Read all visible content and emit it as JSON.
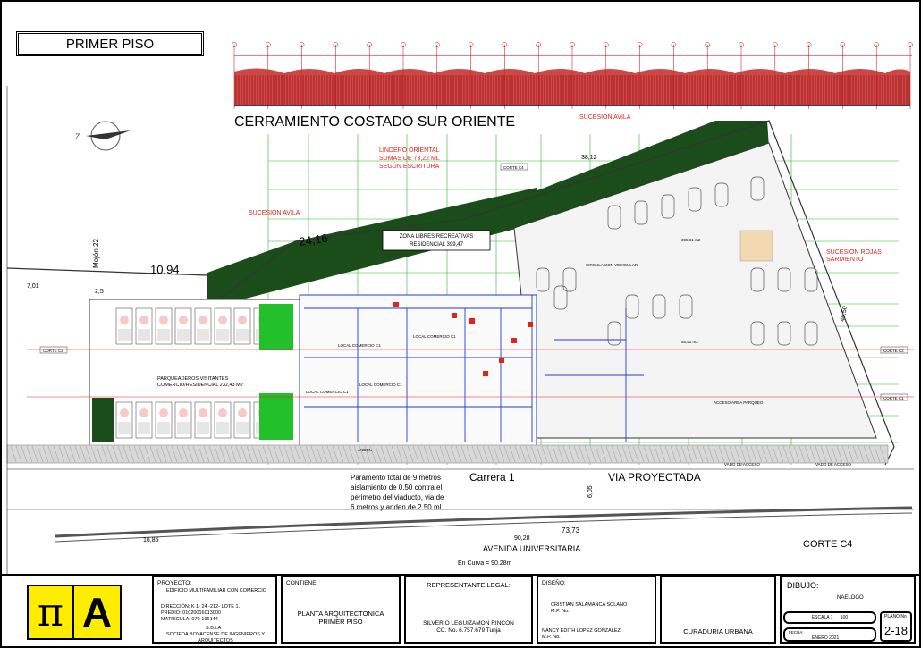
{
  "sheet": {
    "title": "PRIMER PISO",
    "elevation_title": "CERRAMIENTO COSTADO SUR ORIENTE"
  },
  "labels": {
    "sucesion_avila_top": "SUCESION AVILA",
    "sucesion_avila_left": "SUCESION AVILA",
    "lindero": [
      "LINDERO ORIENTAL",
      "SUMAS DE 73,22 ML",
      "SEGÚN ESCRITURA"
    ],
    "zona_libres": [
      "ZONA LIBRES RECREATIVAS",
      "RESIDENCIAL 399,47"
    ],
    "sucesion_rojas": [
      "SUCESION ROJAS",
      "SARMIENTO"
    ],
    "mojon": "Mojón 22",
    "dim_1094": "10,94",
    "dim_2416": "24,16",
    "dim_3812": "38,12",
    "dim_701": "7,01",
    "dim_25": "2,5",
    "dim_4650": "46,50",
    "parqueaderos": [
      "PARQUEADEROS VISITANTES",
      "COMERCIO/RESIDENCIAL 232,43 M2"
    ],
    "local_c1a": "LOCAL COMERCIO C1",
    "local_c1b": "LOCAL COMERCIO C1",
    "local_c1c": "LOCAL COMERCIO C1",
    "local_c1d": "LOCAL COMERCIO C1",
    "corte_c4": "CORTE C4",
    "corte_c3": "CORTE C3",
    "corte_c2": "CORTE C2",
    "corte_c1": "CORTE C1",
    "corte_c4_bottom": "CORTE C4",
    "anden": "ANDEN",
    "paramento": [
      "Paramento total de 9 metros ,",
      "aislamiento de 0.50 contra el",
      "perimetro del viaducto, via de",
      "6 metros  y anden de 2.50 ml"
    ],
    "carrera": "Carrera 1",
    "via": "VIA PROYECTADA",
    "dim_605": "6,05",
    "dim_7373": "73,73",
    "dim_9028": "90,28",
    "dim_1685": "16,85",
    "avenida": "AVENIDA UNIVERSITARIA",
    "en_curva": "En Curva = 90.28m",
    "circulacion": "CIRCULACION VEHICULAR",
    "acceso": "ACCESO AREA PARQUEO",
    "vado1": "VADO DE ACCESO",
    "vado2": "VADO DE ACCESO",
    "dim_area1": "395,61 m2",
    "dim_area2": "55,92 m2"
  },
  "titleblock": {
    "proyecto_label": "PROYECTO:",
    "proyecto_name": "EDIFICIO MULTIFAMILIAR CON  COMERCIO",
    "direccion": "DIRECCIÓN: K 1- 24 -212- LOTE 1.",
    "predio": "PREDIO:   01020016013000",
    "matricula": "MATRICULA: 070-196144",
    "sbia": "S.B.I.A",
    "sociedad": "SOCIEDA BOYACENSE DE INGENIEROS Y ARQUITECTOS",
    "contiene_label": "CONTIENE:",
    "contiene": [
      "PLANTA ARQUITECTONICA",
      "PRIMER PISO"
    ],
    "representante_label": "REPRESENTANTE LEGAL:",
    "representante_name": "SILVERIO LEGUIZAMON RINCON",
    "representante_cc": "CC. No. 6.757.679 Tunja",
    "diseno_label": "DISEÑO:",
    "disenador1": "CRISTIAN SALAMANCA SOLANO",
    "mp1": "M.P. No.",
    "disenador2": "NANCY EDITH LOPEZ GONZALEZ",
    "mp2": "M.P. No.",
    "curaduria": "CURADURIA URBANA",
    "dibujo_label": "DIBUJO:",
    "dibujo": "NAELOGO",
    "escala": "ESCALA 1___100",
    "fecha_label": "FECHA:",
    "fecha": "ENERO 2021",
    "plano_label": "PLANO No",
    "plano": "2-18"
  },
  "logo": {
    "pi": "π",
    "a": "A"
  },
  "colors": {
    "red": "#e2231a",
    "green": "#1a4d1a",
    "bright_green": "#22c02a",
    "blue": "#1f3bd6",
    "line_green": "#00a000"
  }
}
